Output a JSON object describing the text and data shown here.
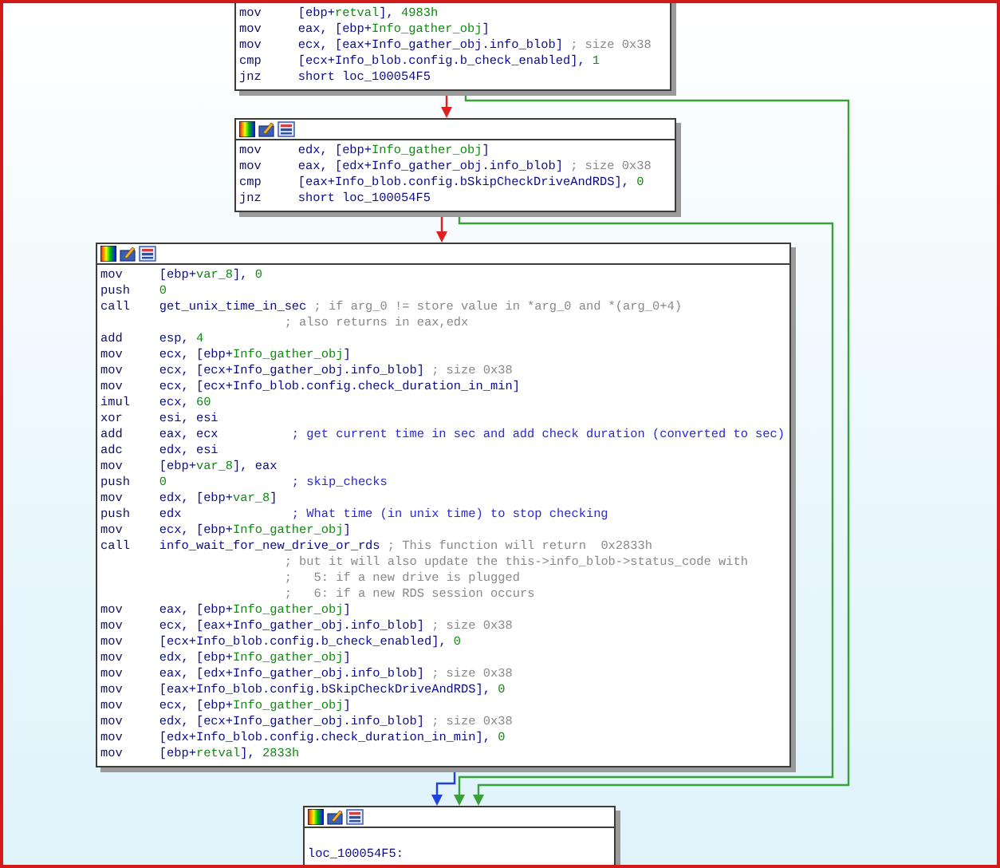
{
  "nodes": [
    {
      "lines": [
        {
          "kind": "insn",
          "mnemonic": "mov",
          "operand": [
            {
              "text": "[ebp+",
              "kind": "plain"
            },
            {
              "text": "retval",
              "kind": "name"
            },
            {
              "text": "], ",
              "kind": "plain"
            },
            {
              "text": "4983h",
              "kind": "num"
            }
          ]
        },
        {
          "kind": "insn",
          "mnemonic": "mov",
          "operand": [
            {
              "text": "eax, [ebp+",
              "kind": "plain"
            },
            {
              "text": "Info_gather_obj",
              "kind": "name"
            },
            {
              "text": "]",
              "kind": "plain"
            }
          ]
        },
        {
          "kind": "insn",
          "mnemonic": "mov",
          "operand": [
            {
              "text": "ecx, [eax+Info_gather_obj.info_blob]",
              "kind": "plain"
            }
          ],
          "comment": "; size 0x38",
          "user_comment": false
        },
        {
          "kind": "insn",
          "mnemonic": "cmp",
          "operand": [
            {
              "text": "[ecx+Info_blob.config.b_check_enabled], ",
              "kind": "plain"
            },
            {
              "text": "1",
              "kind": "num"
            }
          ]
        },
        {
          "kind": "insn",
          "mnemonic": "jnz",
          "operand": [
            {
              "text": "short loc_100054F5",
              "kind": "plain"
            }
          ]
        }
      ]
    },
    {
      "lines": [
        {
          "kind": "insn",
          "mnemonic": "mov",
          "operand": [
            {
              "text": "edx, [ebp+",
              "kind": "plain"
            },
            {
              "text": "Info_gather_obj",
              "kind": "name"
            },
            {
              "text": "]",
              "kind": "plain"
            }
          ]
        },
        {
          "kind": "insn",
          "mnemonic": "mov",
          "operand": [
            {
              "text": "eax, [edx+Info_gather_obj.info_blob]",
              "kind": "plain"
            }
          ],
          "comment": "; size 0x38",
          "user_comment": false
        },
        {
          "kind": "insn",
          "mnemonic": "cmp",
          "operand": [
            {
              "text": "[eax+Info_blob.config.bSkipCheckDriveAndRDS], ",
              "kind": "plain"
            },
            {
              "text": "0",
              "kind": "num"
            }
          ]
        },
        {
          "kind": "insn",
          "mnemonic": "jnz",
          "operand": [
            {
              "text": "short loc_100054F5",
              "kind": "plain"
            }
          ]
        }
      ]
    },
    {
      "lines": [
        {
          "kind": "insn",
          "mnemonic": "mov",
          "operand": [
            {
              "text": "[ebp+",
              "kind": "plain"
            },
            {
              "text": "var_8",
              "kind": "name"
            },
            {
              "text": "], ",
              "kind": "plain"
            },
            {
              "text": "0",
              "kind": "num"
            }
          ]
        },
        {
          "kind": "insn",
          "mnemonic": "push",
          "operand": [
            {
              "text": "0",
              "kind": "num"
            }
          ]
        },
        {
          "kind": "insn",
          "mnemonic": "call",
          "operand": [
            {
              "text": "get_unix_time_in_sec",
              "kind": "plain"
            }
          ],
          "comment": "; if arg_0 != store value in *arg_0 and *(arg_0+4)",
          "user_comment": false
        },
        {
          "kind": "comment",
          "comment": "; also returns in eax,edx"
        },
        {
          "kind": "insn",
          "mnemonic": "add",
          "operand": [
            {
              "text": "esp, ",
              "kind": "plain"
            },
            {
              "text": "4",
              "kind": "num"
            }
          ]
        },
        {
          "kind": "insn",
          "mnemonic": "mov",
          "operand": [
            {
              "text": "ecx, [ebp+",
              "kind": "plain"
            },
            {
              "text": "Info_gather_obj",
              "kind": "name"
            },
            {
              "text": "]",
              "kind": "plain"
            }
          ]
        },
        {
          "kind": "insn",
          "mnemonic": "mov",
          "operand": [
            {
              "text": "ecx, [ecx+Info_gather_obj.info_blob]",
              "kind": "plain"
            }
          ],
          "comment": "; size 0x38",
          "user_comment": false
        },
        {
          "kind": "insn",
          "mnemonic": "mov",
          "operand": [
            {
              "text": "ecx, [ecx+Info_blob.config.check_duration_in_min]",
              "kind": "plain"
            }
          ]
        },
        {
          "kind": "insn",
          "mnemonic": "imul",
          "operand": [
            {
              "text": "ecx, ",
              "kind": "plain"
            },
            {
              "text": "60",
              "kind": "num"
            }
          ]
        },
        {
          "kind": "insn",
          "mnemonic": "xor",
          "operand": [
            {
              "text": "esi, esi",
              "kind": "plain"
            }
          ]
        },
        {
          "kind": "insn",
          "mnemonic": "add",
          "operand": [
            {
              "text": "eax, ecx",
              "kind": "plain"
            }
          ],
          "comment": "; get current time in sec and add check duration (converted to sec)",
          "user_comment": true
        },
        {
          "kind": "insn",
          "mnemonic": "adc",
          "operand": [
            {
              "text": "edx, esi",
              "kind": "plain"
            }
          ]
        },
        {
          "kind": "insn",
          "mnemonic": "mov",
          "operand": [
            {
              "text": "[ebp+",
              "kind": "plain"
            },
            {
              "text": "var_8",
              "kind": "name"
            },
            {
              "text": "], eax",
              "kind": "plain"
            }
          ]
        },
        {
          "kind": "insn",
          "mnemonic": "push",
          "operand": [
            {
              "text": "0",
              "kind": "num"
            }
          ],
          "comment": "; skip_checks",
          "user_comment": true
        },
        {
          "kind": "insn",
          "mnemonic": "mov",
          "operand": [
            {
              "text": "edx, [ebp+",
              "kind": "plain"
            },
            {
              "text": "var_8",
              "kind": "name"
            },
            {
              "text": "]",
              "kind": "plain"
            }
          ]
        },
        {
          "kind": "insn",
          "mnemonic": "push",
          "operand": [
            {
              "text": "edx",
              "kind": "plain"
            }
          ],
          "comment": "; What time (in unix time) to stop checking",
          "user_comment": true
        },
        {
          "kind": "insn",
          "mnemonic": "mov",
          "operand": [
            {
              "text": "ecx, [ebp+",
              "kind": "plain"
            },
            {
              "text": "Info_gather_obj",
              "kind": "name"
            },
            {
              "text": "]",
              "kind": "plain"
            }
          ]
        },
        {
          "kind": "insn",
          "mnemonic": "call",
          "operand": [
            {
              "text": "info_wait_for_new_drive_or_rds",
              "kind": "plain"
            }
          ],
          "comment": "; This function will return  0x2833h",
          "user_comment": false
        },
        {
          "kind": "comment",
          "comment": "; but it will also update the this->info_blob->status_code with"
        },
        {
          "kind": "comment",
          "comment": ";   5: if a new drive is plugged"
        },
        {
          "kind": "comment",
          "comment": ";   6: if a new RDS session occurs"
        },
        {
          "kind": "insn",
          "mnemonic": "mov",
          "operand": [
            {
              "text": "eax, [ebp+",
              "kind": "plain"
            },
            {
              "text": "Info_gather_obj",
              "kind": "name"
            },
            {
              "text": "]",
              "kind": "plain"
            }
          ]
        },
        {
          "kind": "insn",
          "mnemonic": "mov",
          "operand": [
            {
              "text": "ecx, [eax+Info_gather_obj.info_blob]",
              "kind": "plain"
            }
          ],
          "comment": "; size 0x38",
          "user_comment": false
        },
        {
          "kind": "insn",
          "mnemonic": "mov",
          "operand": [
            {
              "text": "[ecx+Info_blob.config.b_check_enabled], ",
              "kind": "plain"
            },
            {
              "text": "0",
              "kind": "num"
            }
          ]
        },
        {
          "kind": "insn",
          "mnemonic": "mov",
          "operand": [
            {
              "text": "edx, [ebp+",
              "kind": "plain"
            },
            {
              "text": "Info_gather_obj",
              "kind": "name"
            },
            {
              "text": "]",
              "kind": "plain"
            }
          ]
        },
        {
          "kind": "insn",
          "mnemonic": "mov",
          "operand": [
            {
              "text": "eax, [edx+Info_gather_obj.info_blob]",
              "kind": "plain"
            }
          ],
          "comment": "; size 0x38",
          "user_comment": false
        },
        {
          "kind": "insn",
          "mnemonic": "mov",
          "operand": [
            {
              "text": "[eax+Info_blob.config.bSkipCheckDriveAndRDS], ",
              "kind": "plain"
            },
            {
              "text": "0",
              "kind": "num"
            }
          ]
        },
        {
          "kind": "insn",
          "mnemonic": "mov",
          "operand": [
            {
              "text": "ecx, [ebp+",
              "kind": "plain"
            },
            {
              "text": "Info_gather_obj",
              "kind": "name"
            },
            {
              "text": "]",
              "kind": "plain"
            }
          ]
        },
        {
          "kind": "insn",
          "mnemonic": "mov",
          "operand": [
            {
              "text": "edx, [ecx+Info_gather_obj.info_blob]",
              "kind": "plain"
            }
          ],
          "comment": "; size 0x38",
          "user_comment": false
        },
        {
          "kind": "insn",
          "mnemonic": "mov",
          "operand": [
            {
              "text": "[edx+Info_blob.config.check_duration_in_min], ",
              "kind": "plain"
            },
            {
              "text": "0",
              "kind": "num"
            }
          ]
        },
        {
          "kind": "insn",
          "mnemonic": "mov",
          "operand": [
            {
              "text": "[ebp+",
              "kind": "plain"
            },
            {
              "text": "retval",
              "kind": "name"
            },
            {
              "text": "], ",
              "kind": "plain"
            },
            {
              "text": "2833h",
              "kind": "num"
            }
          ]
        }
      ]
    },
    {
      "lines": [
        {
          "kind": "blank"
        },
        {
          "kind": "label",
          "label": "loc_100054F5:"
        }
      ]
    }
  ]
}
